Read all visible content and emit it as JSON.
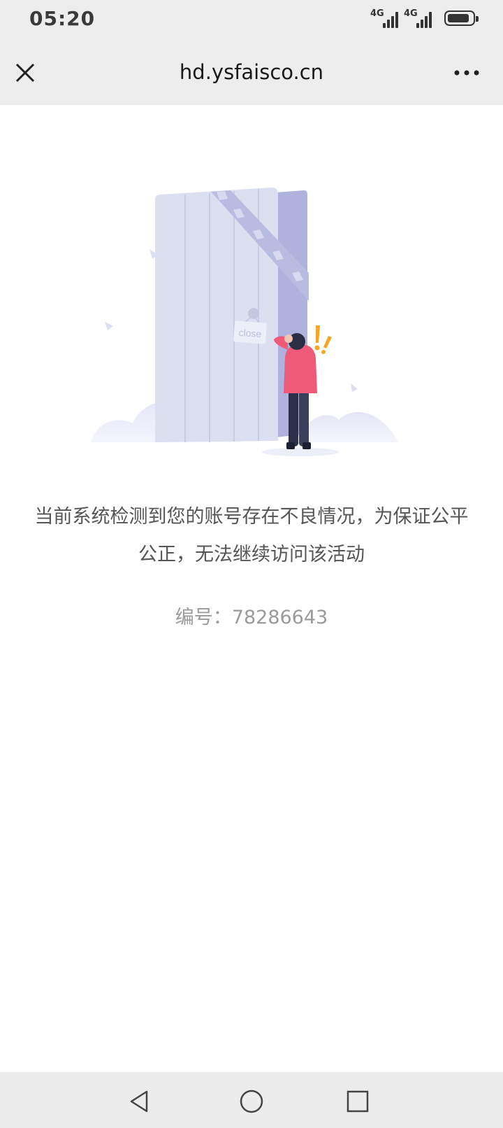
{
  "status_bar": {
    "time": "05:20",
    "signal_1_label": "4G",
    "signal_2_label": "4G",
    "battery_level": 0.8
  },
  "nav_bar": {
    "title": "hd.ysfaisco.cn",
    "close_icon": "close-icon",
    "more_icon": "more-icon"
  },
  "illustration": {
    "sign_text": "close",
    "accent_color": "#ee5a78",
    "alert_color": "#f5a623"
  },
  "content": {
    "message": "当前系统检测到您的账号存在不良情况，为保证公平公正，无法继续访问该活动",
    "code_label": "编号：",
    "code_value": "78286643"
  },
  "system_nav": {
    "back_icon": "back-triangle-icon",
    "home_icon": "home-circle-icon",
    "recents_icon": "recents-square-icon"
  }
}
